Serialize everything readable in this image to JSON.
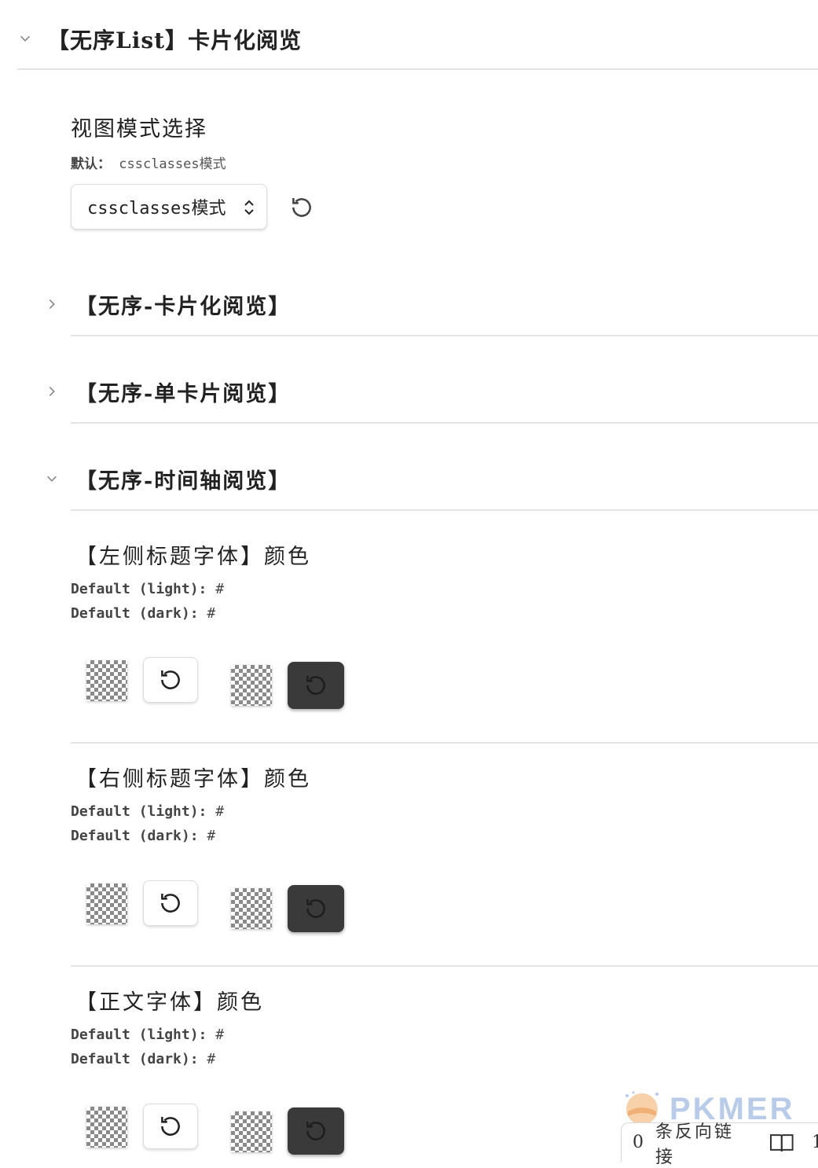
{
  "top_section": {
    "title": "【无序List】卡片化阅览"
  },
  "view_mode": {
    "title": "视图模式选择",
    "default_label": "默认：",
    "default_value": "cssclasses模式",
    "select_value": "cssclasses模式"
  },
  "groups": [
    {
      "title": "【无序-卡片化阅览】"
    },
    {
      "title": "【无序-单卡片阅览】"
    },
    {
      "title": "【无序-时间轴阅览】"
    }
  ],
  "color_settings": [
    {
      "title": "【左侧标题字体】颜色",
      "light_label": "Default (light):",
      "light_value": "#",
      "dark_label": "Default (dark):",
      "dark_value": "#"
    },
    {
      "title": "【右侧标题字体】颜色",
      "light_label": "Default (light):",
      "light_value": "#",
      "dark_label": "Default (dark):",
      "dark_value": "#"
    },
    {
      "title": "【正文字体】颜色",
      "light_label": "Default (light):",
      "light_value": "#",
      "dark_label": "Default (dark):",
      "dark_value": "#"
    }
  ],
  "watermark": {
    "text": "PKMER"
  },
  "status_bar": {
    "backlinks_count": "0",
    "backlinks_label": "条反向链接",
    "trailing_count": "1"
  },
  "colors": {
    "divider": "#e4e4e4",
    "dark_button": "#3a3a3a",
    "watermark": "#b8cbe8"
  }
}
